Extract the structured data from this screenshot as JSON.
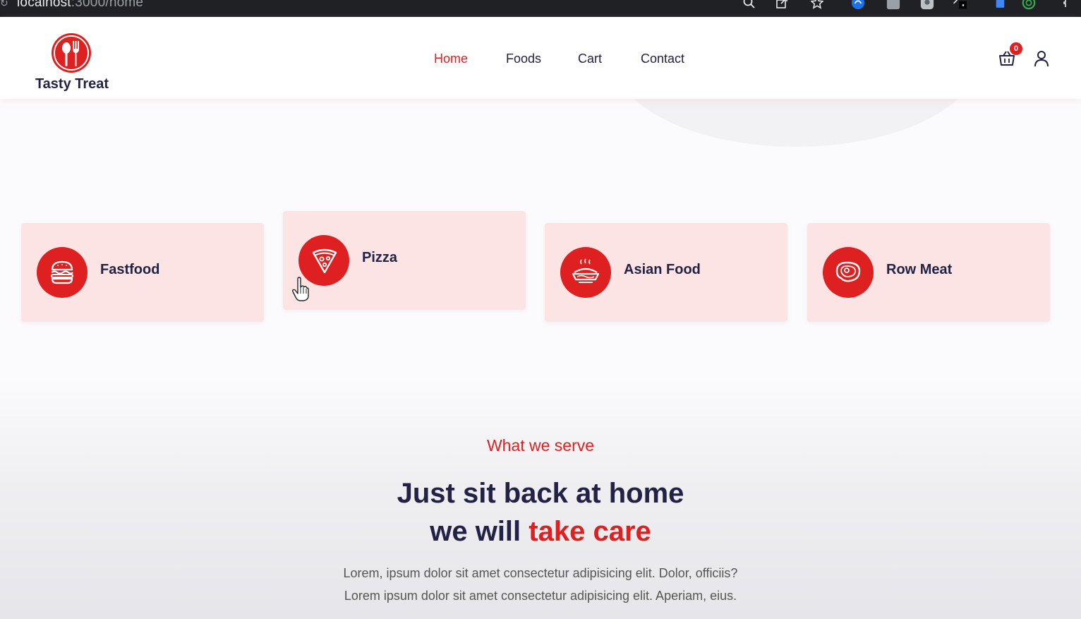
{
  "browser": {
    "url_host": "localhost",
    "url_rest": ":3000/home"
  },
  "header": {
    "brand": "Tasty Treat",
    "nav": [
      {
        "label": "Home",
        "active": true
      },
      {
        "label": "Foods",
        "active": false
      },
      {
        "label": "Cart",
        "active": false
      },
      {
        "label": "Contact",
        "active": false
      }
    ],
    "cart_count": "0"
  },
  "categories": [
    {
      "label": "Fastfood",
      "icon": "burger-icon"
    },
    {
      "label": "Pizza",
      "icon": "pizza-icon"
    },
    {
      "label": "Asian Food",
      "icon": "asian-food-icon"
    },
    {
      "label": "Row Meat",
      "icon": "steak-icon"
    }
  ],
  "service": {
    "subtitle": "What we serve",
    "headline_line1": "Just sit back at home",
    "headline_line2_plain": "we will ",
    "headline_line2_accent": "take care",
    "para_line1": "Lorem, ipsum dolor sit amet consectetur adipisicing elit. Dolor, officiis?",
    "para_line2": "Lorem ipsum dolor sit amet consectetur adipisicing elit. Aperiam, eius."
  },
  "colors": {
    "accent": "#df2020",
    "heading": "#212245",
    "card": "#fde4e4"
  }
}
